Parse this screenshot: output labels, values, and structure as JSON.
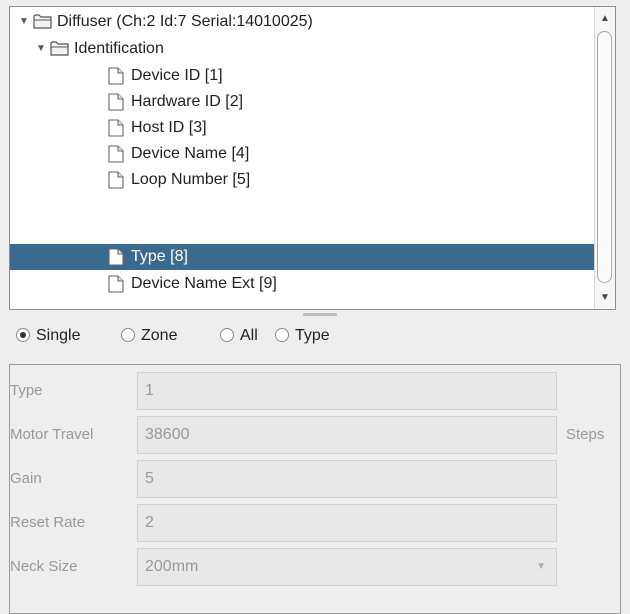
{
  "tree": {
    "rows": [
      {
        "label": "Diffuser (Ch:2 Id:7 Serial:14010025)",
        "icon": "folder-icon",
        "expanded": true
      },
      {
        "label": "Identification",
        "icon": "folder-icon",
        "expanded": true
      },
      {
        "label": "Device ID [1]",
        "icon": "file-icon"
      },
      {
        "label": "Hardware ID [2]",
        "icon": "file-icon"
      },
      {
        "label": "Host ID [3]",
        "icon": "file-icon"
      },
      {
        "label": "Device Name [4]",
        "icon": "file-icon"
      },
      {
        "label": "Loop Number [5]",
        "icon": "file-icon"
      },
      {
        "label": "Type [8]",
        "icon": "file-icon",
        "selected": true
      },
      {
        "label": "Device Name Ext [9]",
        "icon": "file-icon"
      }
    ],
    "expanded_toggle": "▼",
    "selection_color": "#3a6a8e"
  },
  "scrollbar": {
    "up": "▲",
    "down": "▼"
  },
  "mode": {
    "options": [
      "Single",
      "Zone",
      "All",
      "Type"
    ],
    "selected": "Single"
  },
  "props": {
    "type": {
      "label": "Type",
      "value": "1"
    },
    "motor_travel": {
      "label": "Motor Travel",
      "value": "38600",
      "unit": "Steps"
    },
    "gain": {
      "label": "Gain",
      "value": "5"
    },
    "reset_rate": {
      "label": "Reset Rate",
      "value": "2"
    },
    "neck_size": {
      "label": "Neck Size",
      "value": "200mm",
      "caret": "▼"
    }
  }
}
